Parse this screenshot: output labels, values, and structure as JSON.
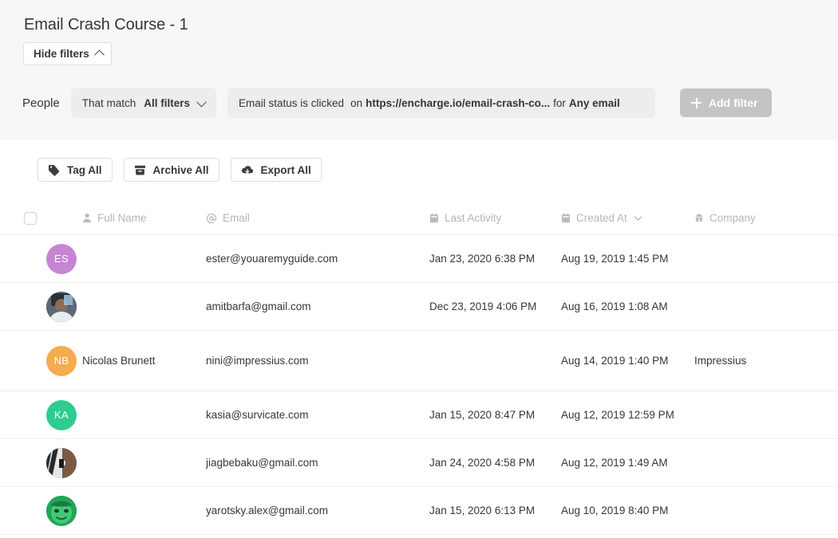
{
  "header": {
    "title": "Email Crash Course - 1",
    "hide_filters_label": "Hide filters",
    "hide_filters_icon": "chevron-up-icon"
  },
  "filters": {
    "entity_label": "People",
    "match_prefix": "That match",
    "match_value": "All filters",
    "match_icon": "chevron-down-icon",
    "condition": {
      "subject": "Email status is clicked",
      "preposition": "on",
      "url": "https://encharge.io/email-crash-co...",
      "for_label": "for",
      "scope": "Any email"
    },
    "add_filter_label": "Add filter",
    "add_filter_icon": "plus-icon"
  },
  "toolbar": {
    "buttons": [
      {
        "label": "Tag All",
        "icon": "tag-icon"
      },
      {
        "label": "Archive All",
        "icon": "archive-icon"
      },
      {
        "label": "Export All",
        "icon": "cloud-download-icon"
      }
    ]
  },
  "table": {
    "select_all_checkbox": "unchecked",
    "columns": [
      {
        "label": "Full Name",
        "icon": "person-icon"
      },
      {
        "label": "Email",
        "icon": "at-icon"
      },
      {
        "label": "Last Activity",
        "icon": "calendar-icon"
      },
      {
        "label": "Created At",
        "icon": "calendar-icon",
        "sort_icon": "chevron-down-icon"
      },
      {
        "label": "Company",
        "icon": "building-icon"
      }
    ],
    "rows": [
      {
        "avatar_type": "initials",
        "initials": "ES",
        "avatar_color": "#c585d3",
        "full_name": "",
        "email": "ester@youaremyguide.com",
        "last_activity": "Jan 23, 2020 6:38 PM",
        "created_at": "Aug 19, 2019 1:45 PM",
        "company": ""
      },
      {
        "avatar_type": "photo",
        "initials": "",
        "avatar_color": "#3d4550",
        "full_name": "",
        "email": "amitbarfa@gmail.com",
        "last_activity": "Dec 23, 2019 4:06 PM",
        "created_at": "Aug 16, 2019 1:08 AM",
        "company": ""
      },
      {
        "avatar_type": "initials",
        "initials": "NB",
        "avatar_color": "#f5ab4f",
        "full_name": "Nicolas Brunett",
        "email": "nini@impressius.com",
        "last_activity": "",
        "created_at": "Aug 14, 2019 1:40 PM",
        "company": "Impressius"
      },
      {
        "avatar_type": "initials",
        "initials": "KA",
        "avatar_color": "#2ecc8f",
        "full_name": "",
        "email": "kasia@survicate.com",
        "last_activity": "Jan 15, 2020 8:47 PM",
        "created_at": "Aug 12, 2019 12:59 PM",
        "company": ""
      },
      {
        "avatar_type": "photo",
        "initials": "",
        "avatar_color": "#2b2b2b",
        "full_name": "",
        "email": "jiagbebaku@gmail.com",
        "last_activity": "Jan 24, 2020 4:58 PM",
        "created_at": "Aug 12, 2019 1:49 AM",
        "company": ""
      },
      {
        "avatar_type": "photo",
        "initials": "",
        "avatar_color": "#2faf63",
        "full_name": "",
        "email": "yarotsky.alex@gmail.com",
        "last_activity": "Jan 15, 2020 6:13 PM",
        "created_at": "Aug 10, 2019 8:40 PM",
        "company": ""
      }
    ]
  }
}
